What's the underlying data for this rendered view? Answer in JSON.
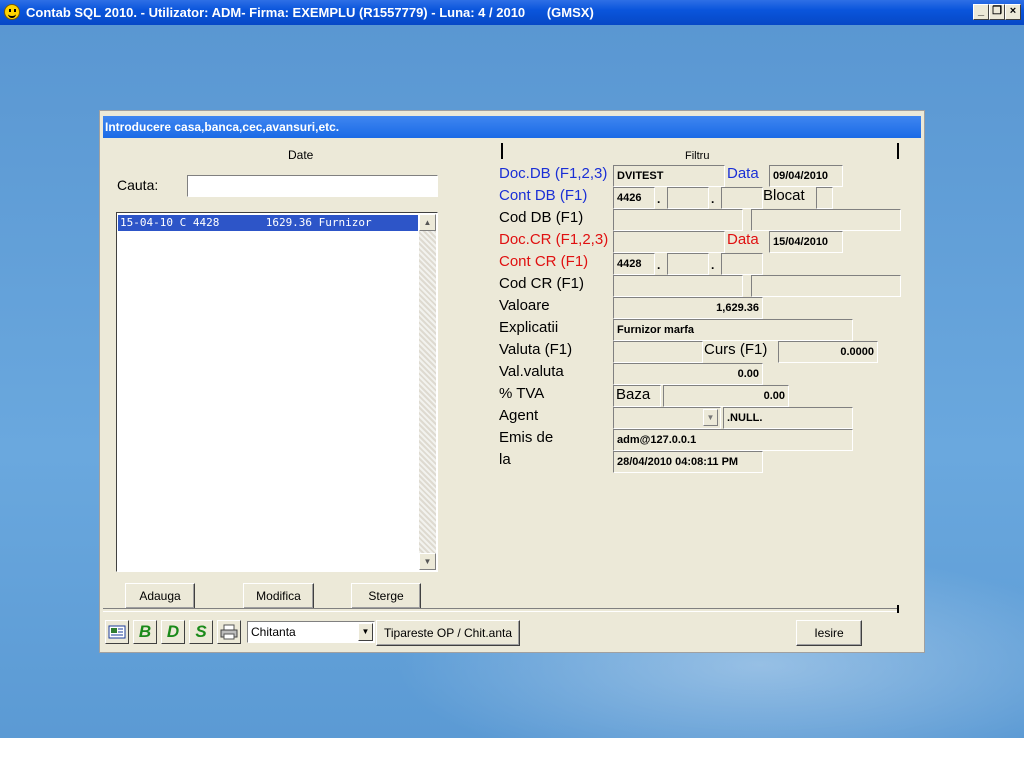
{
  "titlebar": {
    "text": "Contab SQL 2010. - Utilizator: ADM- Firma: EXEMPLU (R1557779) - Luna: 4 / 2010      (GMSX)"
  },
  "dialog": {
    "title": "Introducere casa,banca,cec,avansuri,etc.",
    "tab_left": "Date",
    "tab_right": "Filtru",
    "search_label": "Cauta:",
    "search_value": "",
    "list_items": [
      "15-04-10 C 4428       1629.36 Furnizor"
    ],
    "buttons": {
      "add": "Adauga",
      "modify": "Modifica",
      "delete": "Sterge",
      "print": "Tipareste OP / Chit.anta",
      "exit": "Iesire"
    },
    "toolbar": {
      "b": "B",
      "d": "D",
      "s": "S",
      "doc_type": "Chitanta"
    },
    "form": {
      "doc_db_label": "Doc.DB (F1,2,3)",
      "doc_db_value": "DVITEST",
      "data_db_label": "Data",
      "data_db_value": "09/04/2010",
      "cont_db_label": "Cont DB (F1)",
      "cont_db_value": "4426",
      "blocat_label": "Blocat",
      "cod_db_label": "Cod DB (F1)",
      "doc_cr_label": "Doc.CR (F1,2,3)",
      "data_cr_label": "Data",
      "data_cr_value": "15/04/2010",
      "cont_cr_label": "Cont CR (F1)",
      "cont_cr_value": "4428",
      "cod_cr_label": "Cod CR (F1)",
      "valoare_label": "Valoare",
      "valoare_value": "1,629.36",
      "explicatii_label": "Explicatii",
      "explicatii_value": "Furnizor marfa",
      "valuta_label": "Valuta (F1)",
      "curs_label": "Curs (F1)",
      "curs_value": "0.0000",
      "val_valuta_label": "Val.valuta",
      "val_valuta_value": "0.00",
      "tva_label": "% TVA",
      "baza_label": "Baza",
      "baza_value": "0.00",
      "agent_label": "Agent",
      "agent_value": ".NULL.",
      "emis_label": "Emis de",
      "emis_value": "adm@127.0.0.1",
      "la_label": "la",
      "la_value": "28/04/2010 04:08:11 PM"
    }
  },
  "colors": {
    "titlebar": "#0a55dc",
    "label_blue": "#1a2fd6",
    "label_red": "#e01010",
    "selection": "#2d55c8"
  }
}
